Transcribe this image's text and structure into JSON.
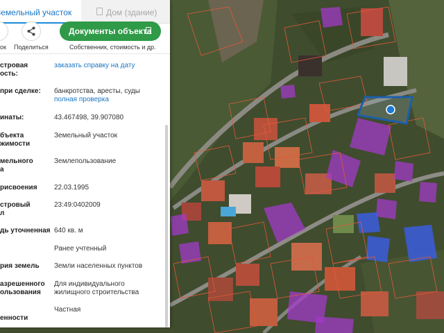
{
  "panel": {
    "tabs": [
      {
        "label": "Земельный участок",
        "active": true
      },
      {
        "label": "Дом (здание)",
        "active": false
      }
    ],
    "actions": {
      "left_label": "ок",
      "share_label": "Поделиться",
      "documents_button": "Документы объекта",
      "documents_subtitle": "Собственник, стоимость и др."
    },
    "rows": [
      {
        "label_lines": [
          "стровая",
          "ость:"
        ],
        "value": "заказать справку на дату",
        "value_is_link": true
      },
      {
        "label_lines": [
          "при сделке:"
        ],
        "value_lines": [
          "банкротства, аресты, суды"
        ],
        "link": "полная проверка"
      },
      {
        "label_lines": [
          "инаты:"
        ],
        "value": "43.467498, 39.907080"
      },
      {
        "label_lines": [
          "бъекта",
          "жимости"
        ],
        "value": "Земельный участок"
      },
      {
        "label_lines": [
          "мельного",
          "а"
        ],
        "value": "Землепользование"
      },
      {
        "label_lines": [
          "рисвоения"
        ],
        "value": "22.03.1995"
      },
      {
        "label_lines": [
          "стровый",
          "л"
        ],
        "value": "23:49:0402009"
      },
      {
        "label_lines": [
          "дь уточненная"
        ],
        "value": "640 кв. м"
      },
      {
        "label_lines": [],
        "value": "Ранее учтенный"
      },
      {
        "label_lines": [
          "рия земель"
        ],
        "value": "Земли населенных пунктов"
      },
      {
        "label_lines": [
          "азрешенного",
          "ользования"
        ],
        "value_lines": [
          "Для индивидуального",
          "жилищного строительства"
        ]
      },
      {
        "label_lines": [
          "енности"
        ],
        "value": "Частная"
      }
    ]
  },
  "colors": {
    "accent_green": "#2f9a47",
    "link_blue": "#1a76c2",
    "parcel_selected": "#1b5fa8",
    "parcel_purple": "#a23ac8",
    "parcel_blue": "#3a5ee8",
    "boundary": "#e05a3a"
  }
}
